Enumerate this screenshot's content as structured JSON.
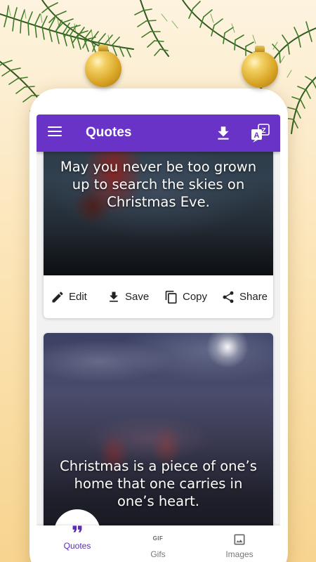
{
  "app": {
    "title": "Quotes"
  },
  "colors": {
    "primary": "#6a33c8",
    "active_nav": "#5b2ab8",
    "background": "#fbe2b0"
  },
  "toolbar": {
    "menu_icon": "hamburger-menu-icon",
    "download_icon": "download-icon",
    "translate_icon": "translate-icon"
  },
  "cards": [
    {
      "quote": "May you never be too grown up to search the skies on Christmas Eve.",
      "actions": [
        {
          "label": "Edit",
          "icon": "pencil-icon"
        },
        {
          "label": "Save",
          "icon": "download-icon"
        },
        {
          "label": "Copy",
          "icon": "copy-icon"
        },
        {
          "label": "Share",
          "icon": "share-icon"
        }
      ]
    },
    {
      "quote": "Christmas is a piece of one’s home that one carries in one’s heart."
    }
  ],
  "bottom_nav": [
    {
      "label": "Quotes",
      "icon": "quote-marks-icon",
      "active": true
    },
    {
      "label": "Gifs",
      "icon": "gif-icon",
      "glyph": "GIF",
      "active": false
    },
    {
      "label": "Images",
      "icon": "image-icon",
      "active": false
    }
  ]
}
